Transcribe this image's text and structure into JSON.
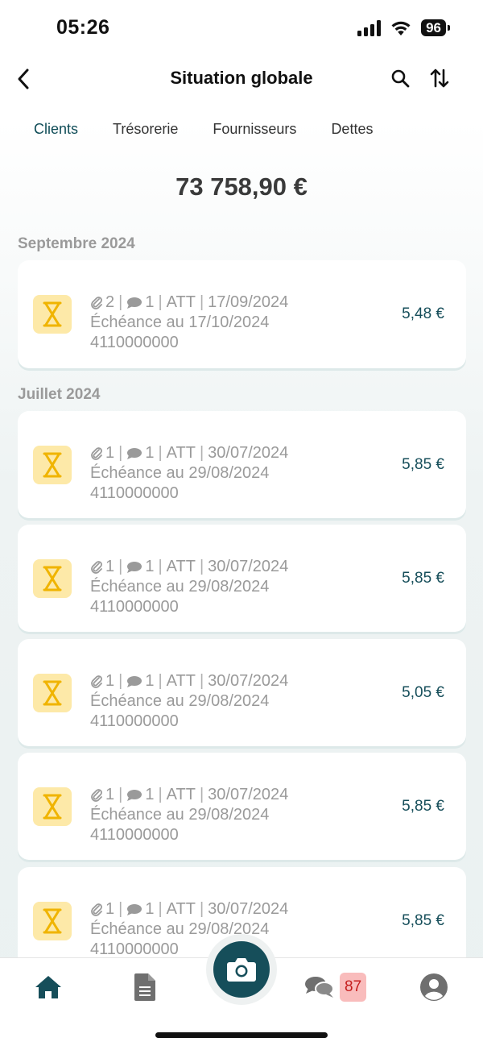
{
  "status": {
    "time": "05:26",
    "battery": "96"
  },
  "header": {
    "title": "Situation globale"
  },
  "tabs": [
    {
      "label": "Clients",
      "active": true
    },
    {
      "label": "Trésorerie",
      "active": false
    },
    {
      "label": "Fournisseurs",
      "active": false
    },
    {
      "label": "Dettes",
      "active": false
    }
  ],
  "total": "73 758,90 €",
  "sections": [
    {
      "label": "Septembre 2024",
      "items": [
        {
          "attachments": "2",
          "comments": "1",
          "status": "ATT",
          "date": "17/09/2024",
          "due": "Échéance au 17/10/2024",
          "account": "4110000000",
          "amount": "5,48 €"
        }
      ]
    },
    {
      "label": "Juillet 2024",
      "items": [
        {
          "attachments": "1",
          "comments": "1",
          "status": "ATT",
          "date": "30/07/2024",
          "due": "Échéance au 29/08/2024",
          "account": "4110000000",
          "amount": "5,85 €"
        },
        {
          "attachments": "1",
          "comments": "1",
          "status": "ATT",
          "date": "30/07/2024",
          "due": "Échéance au 29/08/2024",
          "account": "4110000000",
          "amount": "5,85 €"
        },
        {
          "attachments": "1",
          "comments": "1",
          "status": "ATT",
          "date": "30/07/2024",
          "due": "Échéance au 29/08/2024",
          "account": "4110000000",
          "amount": "5,05 €"
        },
        {
          "attachments": "1",
          "comments": "1",
          "status": "ATT",
          "date": "30/07/2024",
          "due": "Échéance au 29/08/2024",
          "account": "4110000000",
          "amount": "5,85 €"
        },
        {
          "attachments": "1",
          "comments": "1",
          "status": "ATT",
          "date": "30/07/2024",
          "due": "Échéance au 29/08/2024",
          "account": "4110000000",
          "amount": "5,85 €"
        }
      ]
    }
  ],
  "bottom_nav": {
    "messages_badge": "87"
  },
  "colors": {
    "accent": "#164e5a",
    "pending_icon_bg": "#fde9a8",
    "pending_icon": "#f0b400",
    "badge_bg": "#f9bcbc",
    "badge_text": "#c51e1e"
  },
  "icons": {
    "back": "chevron-left-icon",
    "search": "search-icon",
    "sort": "sort-arrows-icon",
    "pending": "hourglass-icon",
    "attachment": "paperclip-icon",
    "comment": "comment-icon",
    "home": "home-icon",
    "document": "document-icon",
    "camera": "camera-icon",
    "messages": "chat-bubbles-icon",
    "profile": "user-icon"
  }
}
